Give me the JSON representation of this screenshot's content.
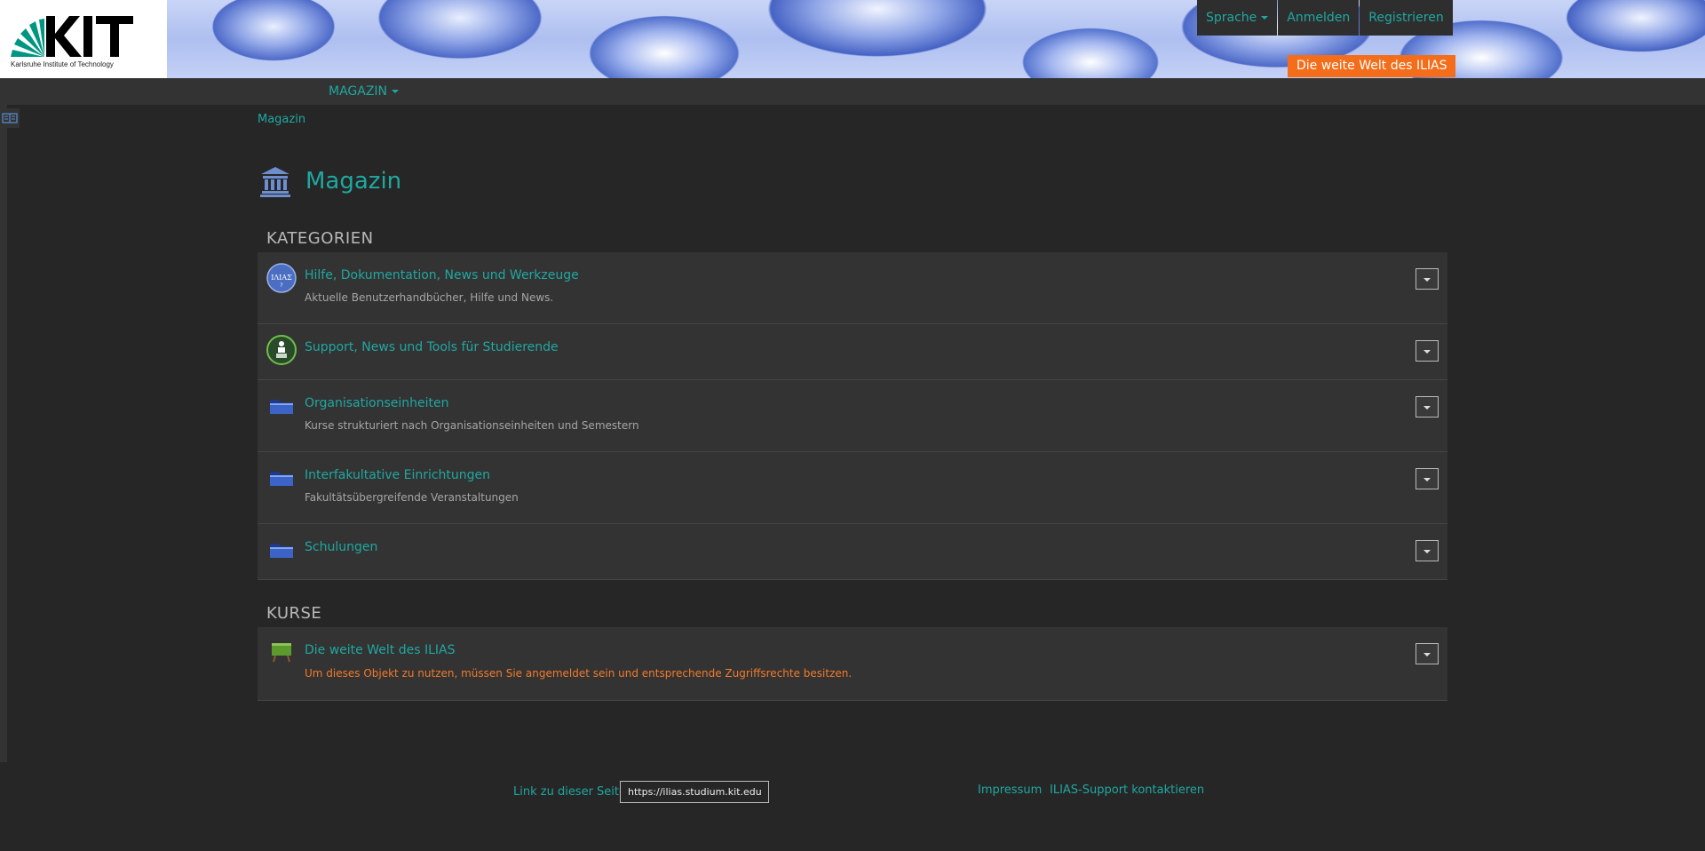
{
  "header": {
    "logo_text": "KIT",
    "logo_subtitle": "Karlsruhe Institute of Technology",
    "nav": {
      "language_label": "Sprache",
      "login_label": "Anmelden",
      "register_label": "Registrieren"
    },
    "course_badge": "Die weite Welt des ILIAS"
  },
  "menubar": {
    "magazin_label": "MAGAZIN"
  },
  "breadcrumb": "Magazin",
  "page_title": "Magazin",
  "sections": {
    "categories": {
      "heading": "KATEGORIEN",
      "items": [
        {
          "title": "Hilfe, Dokumentation, News und Werkzeuge",
          "description": "Aktuelle Benutzerhandbücher, Hilfe und News.",
          "icon": "ilias-help-icon"
        },
        {
          "title": "Support, News und Tools für Studierende",
          "description": "",
          "icon": "student-support-icon"
        },
        {
          "title": "Organisationseinheiten",
          "description": "Kurse strukturiert nach Organisationseinheiten und Semestern",
          "icon": "folder-icon"
        },
        {
          "title": "Interfakultative Einrichtungen",
          "description": "Fakultätsübergreifende Veranstaltungen",
          "icon": "folder-icon"
        },
        {
          "title": "Schulungen",
          "description": "",
          "icon": "folder-icon"
        }
      ]
    },
    "courses": {
      "heading": "KURSE",
      "items": [
        {
          "title": "Die weite Welt des ILIAS",
          "warning": "Um dieses Objekt zu nutzen, müssen Sie angemeldet sein und entsprechende Zugriffsrechte besitzen.",
          "icon": "course-icon"
        }
      ]
    }
  },
  "footer": {
    "link_label": "Link zu dieser Seite:",
    "link_value": "https://ilias.studium.kit.edu/",
    "impressum": "Impressum",
    "support": "ILIAS-Support kontaktieren"
  },
  "colors": {
    "accent": "#1fa8a0",
    "badge": "#f36d1a",
    "warning": "#f37a2a",
    "background": "#262626",
    "panel": "#333333"
  }
}
